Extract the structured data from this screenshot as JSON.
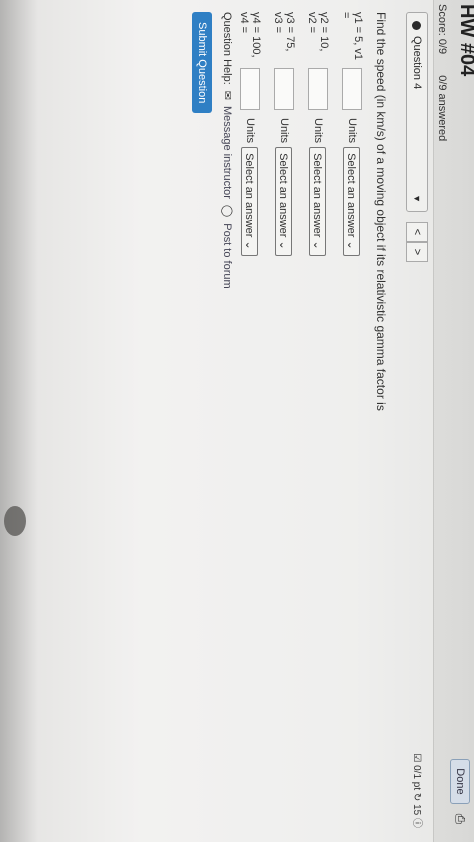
{
  "header": {
    "title": "HW #04",
    "score": "Score: 0/9",
    "answered": "0/9 answered",
    "done": "Done"
  },
  "question": {
    "selector": "Question 4",
    "prev": "<",
    "next": ">",
    "points": "0/1 pt",
    "attempts": "15",
    "prompt": "Find the speed (in km/s) of a moving object if its relativistic gamma factor is"
  },
  "rows": [
    {
      "label": "γ1 = 5, v1 =",
      "units": "Units",
      "select": "Select an answer"
    },
    {
      "label": "γ2 = 10, v2 =",
      "units": "Units",
      "select": "Select an answer"
    },
    {
      "label": "γ3 = 75, v3 =",
      "units": "Units",
      "select": "Select an answer"
    },
    {
      "label": "γ4 = 100, v4 =",
      "units": "Units",
      "select": "Select an answer"
    }
  ],
  "help": {
    "label": "Question Help:",
    "message": "Message instructor",
    "post": "Post to forum"
  },
  "submit": "Submit Question"
}
